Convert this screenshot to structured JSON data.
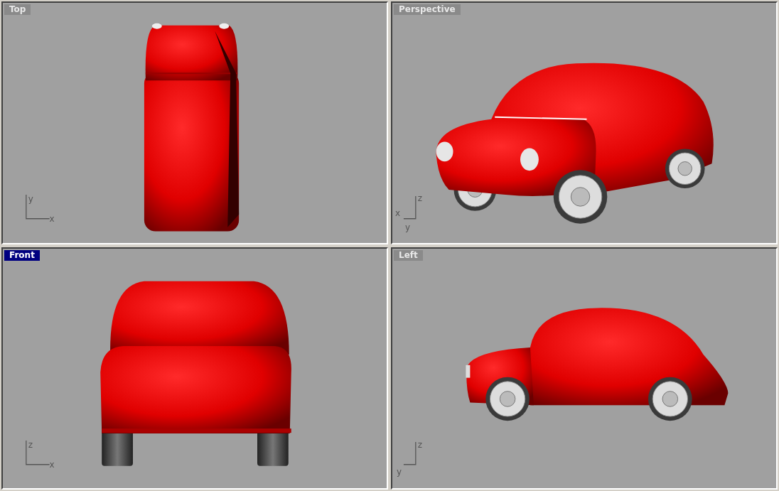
{
  "viewports": [
    {
      "title": "Top",
      "selected": false,
      "kind": "top",
      "axes": [
        "y",
        "x"
      ]
    },
    {
      "title": "Perspective",
      "selected": false,
      "kind": "perspective",
      "axes": [
        "z",
        "x",
        "y"
      ]
    },
    {
      "title": "Front",
      "selected": true,
      "kind": "front",
      "axes": [
        "z",
        "x"
      ]
    },
    {
      "title": "Left",
      "selected": false,
      "kind": "left",
      "axes": [
        "z",
        "y"
      ]
    }
  ]
}
